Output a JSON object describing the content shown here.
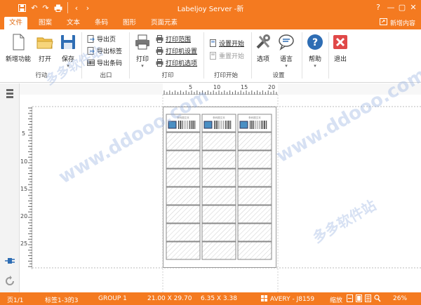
{
  "window": {
    "title": "Labeljoy Server -新"
  },
  "tabs": [
    {
      "label": "文件"
    },
    {
      "label": "图案"
    },
    {
      "label": "文本"
    },
    {
      "label": "条码"
    },
    {
      "label": "图形"
    },
    {
      "label": "页面元素"
    }
  ],
  "share_label": "新增内容",
  "ribbon": {
    "big": {
      "new": "新增功能",
      "open": "打开",
      "save": "保存",
      "print": "打印",
      "options": "选项",
      "language": "语言",
      "help": "帮助",
      "exit": "退出"
    },
    "export": {
      "page": "导出页",
      "labels": "导出标签",
      "barcodes": "导出条码"
    },
    "printing": {
      "range": "打印范围",
      "setup": "打印机设置",
      "options": "打印机选项"
    },
    "start": {
      "set": "设置开始",
      "reset": "重置开始"
    },
    "groups": {
      "action": "行动",
      "export": "出口",
      "print": "打印",
      "start": "打印开始",
      "settings": "设置"
    }
  },
  "ruler": {
    "h": [
      "5",
      "10",
      "15",
      "20"
    ],
    "v": [
      "5",
      "10",
      "15",
      "20",
      "25"
    ]
  },
  "label_text": "条码图文本",
  "status": {
    "page": "页1/1",
    "labels": "标签1-3的3",
    "group": "GROUP 1",
    "page_size": "21.00 X 29.70",
    "label_size": "6.35 X 3.38",
    "template": "AVERY - J8159",
    "zoom_label": "缩放",
    "zoom": "26%"
  },
  "watermark": "www.ddooo.com",
  "watermark_cn": "多多软件站"
}
